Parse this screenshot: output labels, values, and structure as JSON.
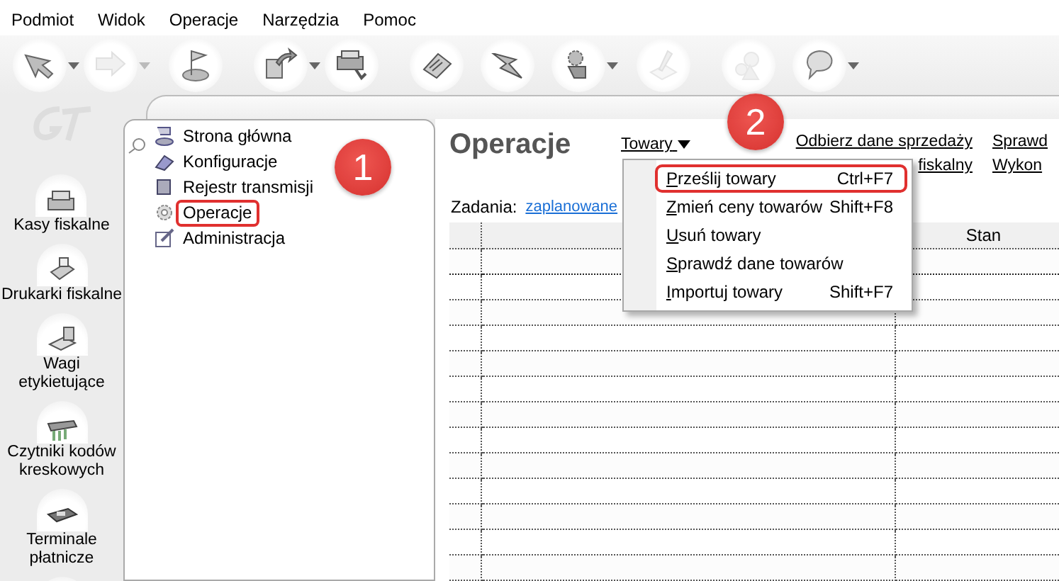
{
  "menu_bar": [
    "Podmiot",
    "Widok",
    "Operacje",
    "Narzędzia",
    "Pomoc"
  ],
  "toolbar": [
    {
      "kind": "pointer",
      "disabled": false,
      "dropdown": true
    },
    {
      "kind": "send",
      "disabled": true,
      "dropdown": true
    },
    {
      "kind": "flag",
      "disabled": false,
      "dropdown": false
    },
    {
      "kind": "export",
      "disabled": false,
      "dropdown": true
    },
    {
      "kind": "register",
      "disabled": false,
      "dropdown": false
    },
    {
      "kind": "clipboard",
      "disabled": false,
      "dropdown": false
    },
    {
      "kind": "bolt",
      "disabled": false,
      "dropdown": false
    },
    {
      "kind": "hand",
      "disabled": false,
      "dropdown": true
    },
    {
      "kind": "pen",
      "disabled": true,
      "dropdown": false
    },
    {
      "kind": "gears",
      "disabled": true,
      "dropdown": false
    },
    {
      "kind": "help",
      "disabled": false,
      "dropdown": true
    }
  ],
  "logo": {
    "kind": "gt"
  },
  "devices": [
    {
      "label": "Kasy fiskalne",
      "kind": "register"
    },
    {
      "label": "Drukarki fiskalne",
      "kind": "printer"
    },
    {
      "label": "Wagi etykietujące",
      "kind": "scale"
    },
    {
      "label": "Czytniki kodów kreskowych",
      "kind": "scanner"
    },
    {
      "label": "Terminale płatnicze",
      "kind": "terminal"
    },
    {
      "kind": "tool"
    }
  ],
  "tree": [
    {
      "label": "Strona główna",
      "kind": "home",
      "highlighted": false
    },
    {
      "label": "Konfiguracje",
      "kind": "config",
      "highlighted": false
    },
    {
      "label": "Rejestr transmisji",
      "kind": "log",
      "highlighted": false
    },
    {
      "label": "Operacje",
      "kind": "gear",
      "highlighted": true
    },
    {
      "label": "Administracja",
      "kind": "admin",
      "highlighted": false
    }
  ],
  "content": {
    "title": "Operacje",
    "dropdown_link": "Towary",
    "links": [
      [
        "Odbierz dane sprzedaży",
        "fiskalny"
      ],
      [
        "Sprawd",
        "Wykon"
      ]
    ],
    "tasks_label": "Zadania:",
    "tasks_filter": "zaplanowane",
    "table": {
      "column_3": "Stan",
      "rows": [
        {
          "selected": true
        },
        {
          "selected": false
        },
        {
          "selected": false
        },
        {
          "selected": false
        },
        {
          "selected": false
        },
        {
          "selected": false
        },
        {
          "selected": false
        },
        {
          "selected": false
        },
        {
          "selected": false
        },
        {
          "selected": false
        },
        {
          "selected": false
        },
        {
          "selected": false
        },
        {
          "selected": false
        }
      ]
    }
  },
  "dropdown_menu": [
    {
      "label": "Prześlij towary",
      "shortcut": "Ctrl+F7",
      "highlighted": true
    },
    {
      "label": "Zmień ceny towarów",
      "shortcut": "Shift+F8",
      "highlighted": false
    },
    {
      "label": "Usuń towary",
      "highlighted": false
    },
    {
      "label": "Sprawdź dane towarów",
      "highlighted": false
    },
    {
      "label": "Importuj towary",
      "shortcut": "Shift+F7",
      "highlighted": false
    }
  ],
  "step_badges": [
    "1",
    "2"
  ]
}
